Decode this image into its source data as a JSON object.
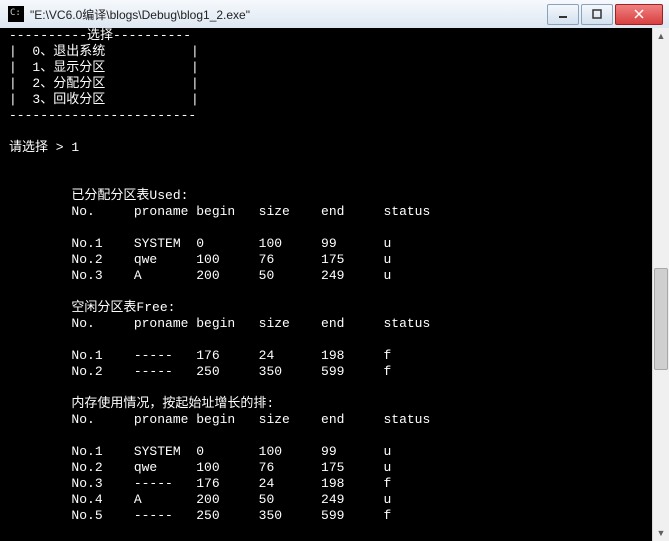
{
  "window": {
    "title": "\"E:\\VC6.0编译\\blogs\\Debug\\blog1_2.exe\""
  },
  "menu": {
    "divider": "----------选择----------",
    "items": [
      "|  0、退出系统           |",
      "|  1、显示分区           |",
      "|  2、分配分区           |",
      "|  3、回收分区           |"
    ],
    "bottom": "------------------------"
  },
  "prompt": {
    "label": "请选择 >",
    "input": "1"
  },
  "used": {
    "title": "已分配分区表Used:",
    "headers": [
      "No.",
      "proname",
      "begin",
      "size",
      "end",
      "status"
    ],
    "rows": [
      [
        "No.1",
        "SYSTEM",
        "0",
        "100",
        "99",
        "u"
      ],
      [
        "No.2",
        "qwe",
        "100",
        "76",
        "175",
        "u"
      ],
      [
        "No.3",
        "A",
        "200",
        "50",
        "249",
        "u"
      ]
    ]
  },
  "free": {
    "title": "空闲分区表Free:",
    "headers": [
      "No.",
      "proname",
      "begin",
      "size",
      "end",
      "status"
    ],
    "rows": [
      [
        "No.1",
        "-----",
        "176",
        "24",
        "198",
        "f"
      ],
      [
        "No.2",
        "-----",
        "250",
        "350",
        "599",
        "f"
      ]
    ]
  },
  "memory": {
    "title": "内存使用情况，按起始址增长的排:",
    "headers": [
      "No.",
      "proname",
      "begin",
      "size",
      "end",
      "status"
    ],
    "rows": [
      [
        "No.1",
        "SYSTEM",
        "0",
        "100",
        "99",
        "u"
      ],
      [
        "No.2",
        "qwe",
        "100",
        "76",
        "175",
        "u"
      ],
      [
        "No.3",
        "-----",
        "176",
        "24",
        "198",
        "f"
      ],
      [
        "No.4",
        "A",
        "200",
        "50",
        "249",
        "u"
      ],
      [
        "No.5",
        "-----",
        "250",
        "350",
        "599",
        "f"
      ]
    ]
  }
}
